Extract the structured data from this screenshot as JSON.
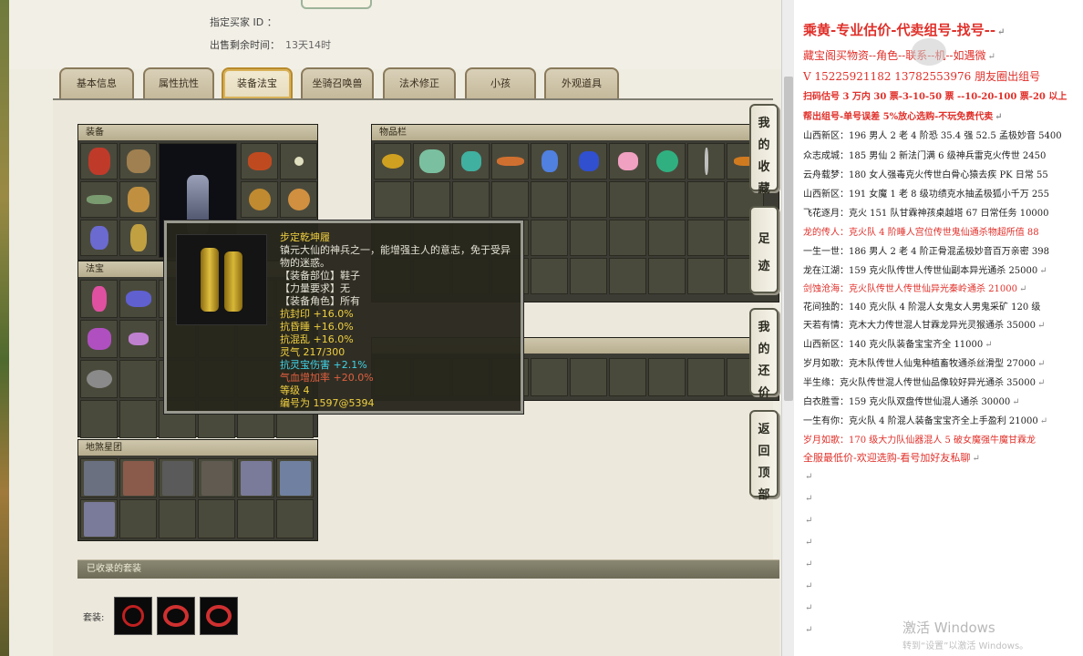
{
  "listing": {
    "buyer_label": "指定买家 ID ：",
    "remaining_label": "出售剩余时间：",
    "remaining_value": "13天14时"
  },
  "tabs": [
    {
      "label": "基本信息",
      "active": false
    },
    {
      "label": "属性抗性",
      "active": false
    },
    {
      "label": "装备法宝",
      "active": true
    },
    {
      "label": "坐骑召唤兽",
      "active": false
    },
    {
      "label": "法术修正",
      "active": false
    },
    {
      "label": "小孩",
      "active": false
    },
    {
      "label": "外观道具",
      "active": false
    }
  ],
  "panels": {
    "equipment": "装备",
    "inventory": "物品栏",
    "treasure": "法宝",
    "earth_spirit": "地煞星团",
    "collected_sets": "已收录的套装",
    "set_label": "套装:"
  },
  "tooltip": {
    "name": "步定乾坤履",
    "desc": "镇元大仙的神兵之一，能增强主人的意志，免于受异物的迷惑。",
    "slot": "【装备部位】鞋子",
    "power": "【力量要求】无",
    "role": "【装备角色】所有",
    "attr1": "抗封印 +16.0%",
    "attr2": "抗昏睡 +16.0%",
    "attr3": "抗混乱 +16.0%",
    "spirit": "灵气 217/300",
    "anti_treasure": "抗灵宝伤害 +2.1%",
    "hp_bonus": "气血增加率 +20.0%",
    "level": "等级 4",
    "serial": "编号为 1597@5394"
  },
  "side_buttons": [
    {
      "label": "我的收藏"
    },
    {
      "label": "足迹"
    },
    {
      "label": "我的还价"
    },
    {
      "label": "返回顶部"
    }
  ],
  "notes": [
    {
      "text": "乘黄-专业估价-代卖组号-找号--",
      "color": "#e0302a"
    },
    {
      "text": "藏宝阁买物资--角色--联系--机--如遇微",
      "color": "#e0302a"
    },
    {
      "text": "V 15225921182   13782553976 朋友圈出组号",
      "color": "#e0302a"
    },
    {
      "text": "扫码估号 3 万内 30 票-3-10-50 票 --10-20-100 票-20 以上",
      "color": "#e0302a"
    },
    {
      "text": "帮出组号-单号误差 5%放心选购-不玩免费代卖",
      "color": "#e0302a"
    },
    {
      "text": "山西新区：196 男人 2 老 4 阶恐 35.4 强 52.5 孟极妙音 5400",
      "color": "#222222"
    },
    {
      "text": "众志成城：185 男仙 2 新法门满 6 级神兵雷克火传世 2450",
      "color": "#222222"
    },
    {
      "text": "云舟载梦：180 女人强毒克火传世白骨心猿去疾 PK 日常 55",
      "color": "#222222"
    },
    {
      "text": "山西新区：191 女魔 1 老 8 级功绩克水抽孟极狐小千万 255",
      "color": "#222222"
    },
    {
      "text": "飞花逐月：克火 151 队甘霖神孩桌越塔 67 日常任务 10000",
      "color": "#222222"
    },
    {
      "text": "龙的传人：克火队 4 阶睡人宫位传世鬼仙通杀物超所值 88",
      "color": "#e0302a"
    },
    {
      "text": "一生一世：186 男人 2 老 4 阶正骨混孟极妙音百万亲密 398",
      "color": "#222222"
    },
    {
      "text": "龙在江湖：159 克火队传世人传世仙副本异光通杀 25000",
      "color": "#222222"
    },
    {
      "text": "剑蚀沧海：克火队传世人传世仙异光秦岭通杀 21000",
      "color": "#e0302a"
    },
    {
      "text": "花间独酌：140 克火队 4 阶混人女鬼女人男鬼采矿 120 级",
      "color": "#222222"
    },
    {
      "text": "天若有情：克木大力传世混人甘霖龙异光灵猴通杀 35000",
      "color": "#222222"
    },
    {
      "text": "山西新区：140 克火队装备宝宝齐全 11000",
      "color": "#222222"
    },
    {
      "text": "岁月如歌：克木队传世人仙鬼种植畜牧通杀丝滑型 27000",
      "color": "#222222"
    },
    {
      "text": "半生缘：克火队传世混人传世仙品像较好异光通杀 35000",
      "color": "#222222"
    },
    {
      "text": "白衣胜雪：159 克火队双盘传世仙混人通杀 30000",
      "color": "#222222"
    },
    {
      "text": "一生有你：克火队 4 阶混人装备宝宝齐全上手盈利 21000",
      "color": "#222222"
    },
    {
      "text": "岁月如歌：170 级大力队仙器混人 5 破女魔强牛魔甘霖龙",
      "color": "#e0302a"
    },
    {
      "text": "全服最低价-欢迎选购-看号加好友私聊",
      "color": "#e0302a"
    }
  ],
  "watermark": {
    "line1": "激活 Windows",
    "line2": "转到“设置”以激活 Windows。"
  },
  "colors": {
    "accent_red": "#e0302a",
    "tooltip_name": "#f0d040",
    "tooltip_cyan": "#40d4e8",
    "tooltip_red": "#e06040"
  }
}
